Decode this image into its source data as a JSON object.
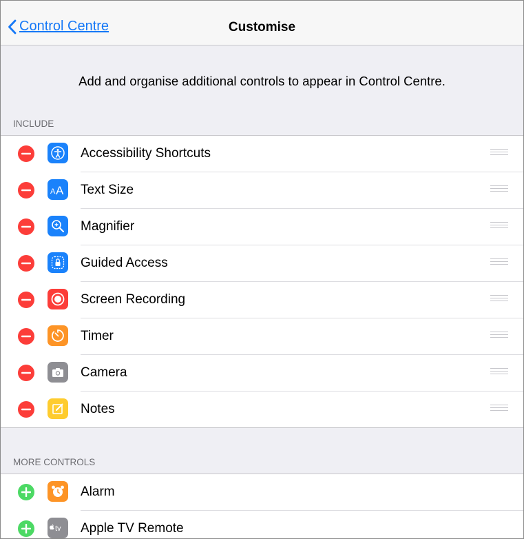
{
  "navbar": {
    "back_label": "Control Centre",
    "title": "Customise"
  },
  "description": "Add and organise additional controls to appear in Control Centre.",
  "include": {
    "header": "INCLUDE",
    "items": [
      {
        "label": "Accessibility Shortcuts",
        "icon": "accessibility-icon",
        "color": "#1a82fb"
      },
      {
        "label": "Text Size",
        "icon": "text-size-icon",
        "color": "#1a82fb"
      },
      {
        "label": "Magnifier",
        "icon": "magnifier-icon",
        "color": "#1a82fb"
      },
      {
        "label": "Guided Access",
        "icon": "guided-access-icon",
        "color": "#1a82fb"
      },
      {
        "label": "Screen Recording",
        "icon": "screen-recording-icon",
        "color": "#fc3d39"
      },
      {
        "label": "Timer",
        "icon": "timer-icon",
        "color": "#fd9426"
      },
      {
        "label": "Camera",
        "icon": "camera-icon",
        "color": "#8e8e93"
      },
      {
        "label": "Notes",
        "icon": "notes-icon",
        "color": "#fecc2f"
      }
    ]
  },
  "more_controls": {
    "header": "MORE CONTROLS",
    "items": [
      {
        "label": "Alarm",
        "icon": "alarm-icon",
        "color": "#fd9426"
      },
      {
        "label": "Apple TV Remote",
        "icon": "apple-tv-remote-icon",
        "color": "#8e8e93",
        "icon_text": "tv"
      }
    ]
  }
}
